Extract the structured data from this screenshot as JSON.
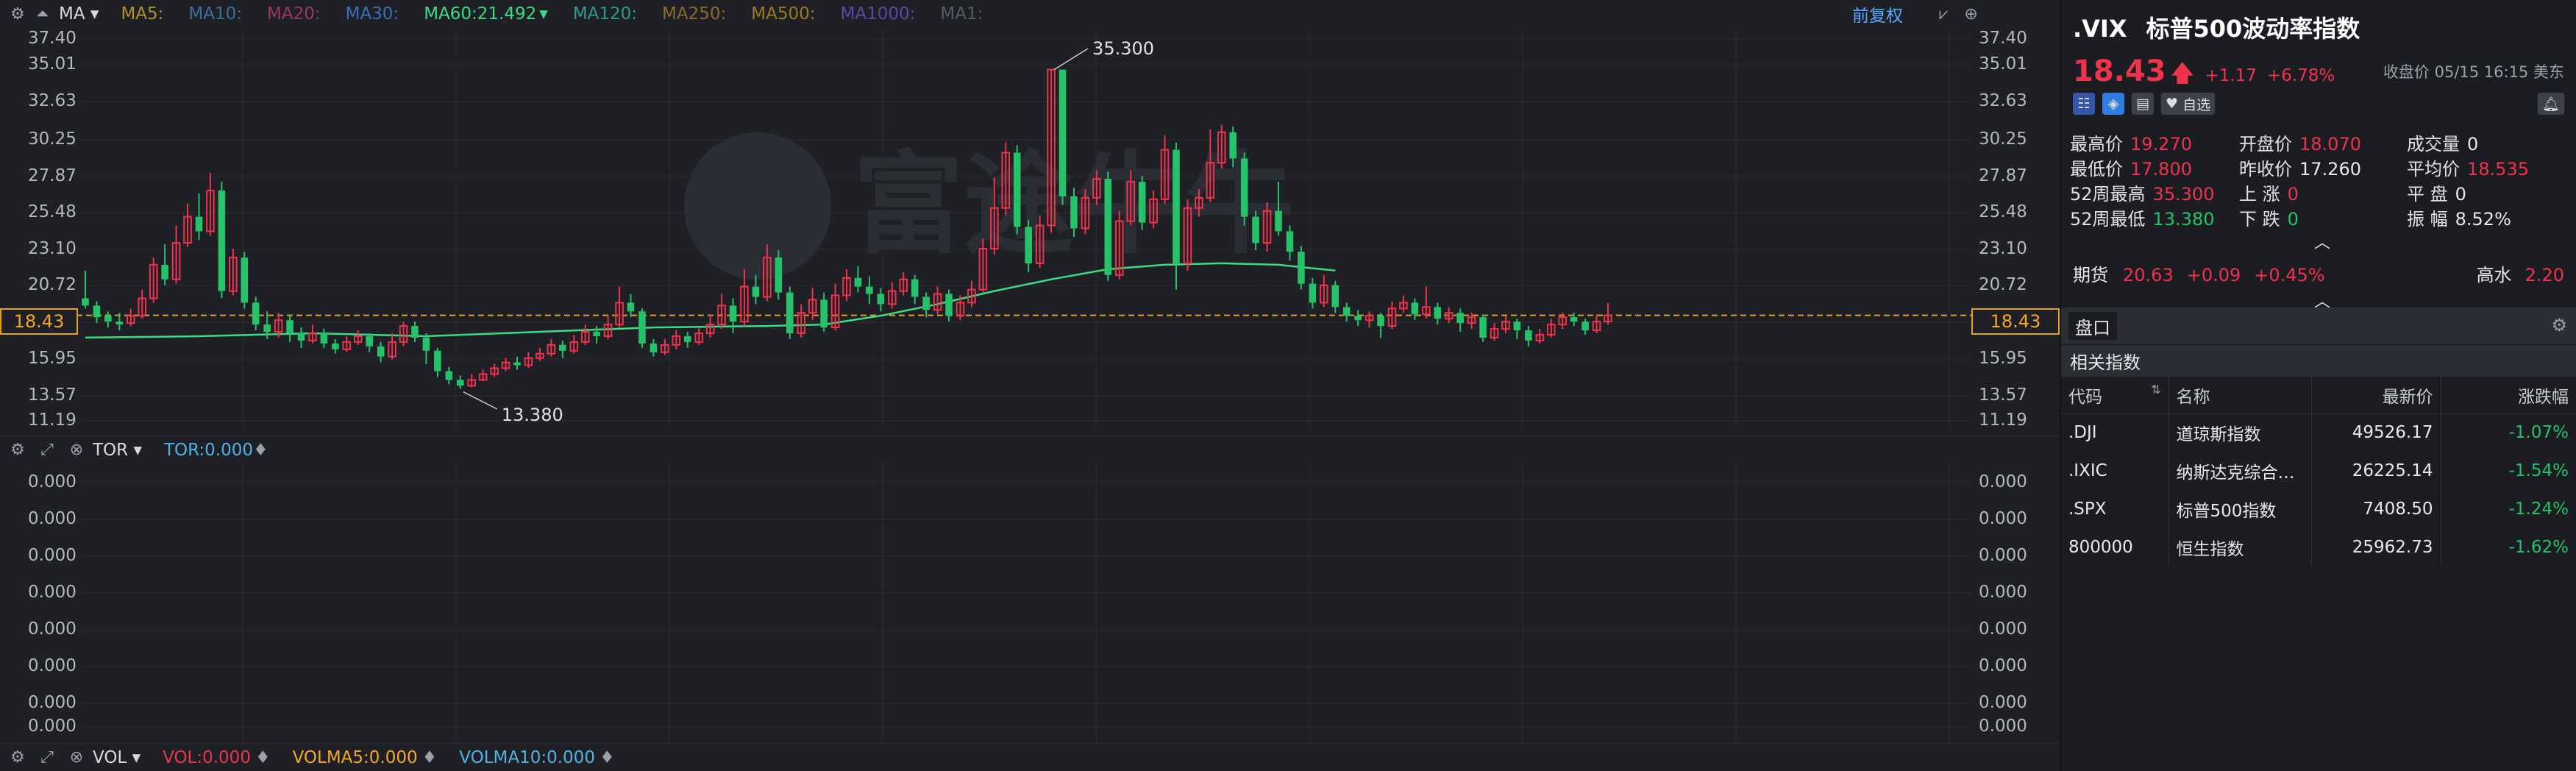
{
  "chart": {
    "toolbar": {
      "ma_label": "MA",
      "ma_items": [
        {
          "label": "MA5:",
          "color": "#b1912a"
        },
        {
          "label": "MA10:",
          "color": "#3e6f9c"
        },
        {
          "label": "MA20:",
          "color": "#a0336d"
        },
        {
          "label": "MA30:",
          "color": "#3b6fb6"
        },
        {
          "label": "MA60:21.492",
          "color": "#3ddc84"
        },
        {
          "label": "MA120:",
          "color": "#2e9a8d"
        },
        {
          "label": "MA250:",
          "color": "#8a6a2c"
        },
        {
          "label": "MA500:",
          "color": "#9c7a1c"
        },
        {
          "label": "MA1000:",
          "color": "#5a4aa8"
        },
        {
          "label": "MA1:",
          "color": "#565b66"
        }
      ],
      "adjust_button": "前复权"
    },
    "price_axis": [
      "37.40",
      "35.01",
      "32.63",
      "30.25",
      "27.87",
      "25.48",
      "23.10",
      "20.72",
      "18.43",
      "15.95",
      "13.57",
      "11.19"
    ],
    "current_price_tag": "18.43",
    "high_annotation": "35.300",
    "low_annotation": "13.380",
    "tor": {
      "label": "TOR",
      "value_label": "TOR:0.000",
      "axis": [
        "0.000",
        "0.000",
        "0.000",
        "0.000",
        "0.000",
        "0.000",
        "0.000",
        "0.000"
      ]
    },
    "vol": {
      "label": "VOL",
      "vol": "VOL:0.000",
      "volma5": "VOLMA5:0.000",
      "volma10": "VOLMA10:0.000"
    },
    "watermark": "富途牛牛"
  },
  "chart_data": {
    "type": "candlestick",
    "ylim": [
      11.19,
      37.4
    ],
    "candles": [
      [
        19.6,
        19.1,
        21.5,
        18.9
      ],
      [
        19.1,
        18.3,
        19.4,
        17.9
      ],
      [
        18.4,
        18.0,
        18.7,
        17.6
      ],
      [
        18.0,
        17.8,
        18.6,
        17.4
      ],
      [
        17.9,
        18.4,
        18.9,
        17.7
      ],
      [
        18.4,
        19.6,
        20.2,
        18.2
      ],
      [
        19.6,
        21.9,
        22.4,
        19.3
      ],
      [
        21.9,
        20.9,
        23.3,
        20.5
      ],
      [
        20.9,
        23.4,
        24.6,
        20.6
      ],
      [
        23.4,
        25.2,
        26.1,
        23.1
      ],
      [
        25.2,
        24.2,
        26.8,
        23.6
      ],
      [
        24.2,
        27.0,
        28.2,
        23.9
      ],
      [
        27.0,
        20.1,
        27.6,
        19.6
      ],
      [
        20.1,
        22.4,
        23.0,
        19.8
      ],
      [
        22.4,
        19.3,
        22.8,
        18.9
      ],
      [
        19.3,
        17.8,
        19.7,
        17.4
      ],
      [
        17.8,
        17.3,
        18.7,
        16.8
      ],
      [
        17.3,
        18.1,
        18.6,
        16.9
      ],
      [
        18.1,
        17.2,
        18.5,
        16.6
      ],
      [
        17.2,
        16.7,
        17.6,
        16.2
      ],
      [
        16.7,
        17.2,
        17.8,
        16.5
      ],
      [
        17.2,
        16.5,
        17.5,
        16.2
      ],
      [
        16.5,
        16.1,
        16.8,
        15.8
      ],
      [
        16.1,
        16.6,
        17.0,
        15.9
      ],
      [
        16.6,
        17.0,
        17.4,
        16.4
      ],
      [
        17.0,
        16.3,
        17.2,
        15.9
      ],
      [
        16.3,
        15.6,
        16.6,
        15.2
      ],
      [
        15.6,
        16.6,
        17.2,
        15.4
      ],
      [
        16.6,
        17.7,
        18.0,
        16.3
      ],
      [
        17.7,
        16.9,
        18.0,
        16.6
      ],
      [
        16.9,
        16.0,
        17.2,
        15.1
      ],
      [
        16.0,
        14.6,
        16.2,
        14.2
      ],
      [
        14.6,
        14.0,
        14.9,
        13.7
      ],
      [
        14.0,
        13.6,
        14.3,
        13.38
      ],
      [
        13.6,
        14.0,
        14.4,
        13.5
      ],
      [
        14.0,
        14.4,
        14.7,
        13.9
      ],
      [
        14.4,
        14.8,
        15.1,
        14.2
      ],
      [
        14.8,
        15.2,
        15.5,
        14.6
      ],
      [
        15.2,
        15.0,
        15.6,
        14.7
      ],
      [
        15.0,
        15.5,
        15.9,
        14.8
      ],
      [
        15.5,
        15.8,
        16.2,
        15.3
      ],
      [
        15.8,
        16.4,
        16.8,
        15.6
      ],
      [
        16.4,
        16.0,
        16.7,
        15.5
      ],
      [
        16.0,
        16.6,
        17.1,
        15.8
      ],
      [
        16.6,
        17.3,
        17.8,
        16.4
      ],
      [
        17.3,
        17.0,
        17.7,
        16.5
      ],
      [
        17.0,
        17.8,
        18.4,
        16.8
      ],
      [
        17.8,
        19.3,
        20.4,
        17.6
      ],
      [
        19.3,
        18.7,
        19.9,
        18.3
      ],
      [
        18.7,
        16.5,
        18.9,
        16.2
      ],
      [
        16.5,
        15.9,
        16.8,
        15.6
      ],
      [
        15.9,
        16.4,
        16.8,
        15.7
      ],
      [
        16.4,
        17.0,
        17.4,
        16.1
      ],
      [
        17.0,
        16.6,
        17.3,
        16.2
      ],
      [
        16.6,
        17.2,
        17.6,
        16.4
      ],
      [
        17.2,
        17.8,
        18.5,
        16.9
      ],
      [
        17.8,
        19.1,
        19.9,
        17.5
      ],
      [
        19.1,
        18.0,
        19.6,
        17.2
      ],
      [
        18.0,
        20.4,
        21.6,
        17.7
      ],
      [
        20.4,
        19.7,
        21.2,
        19.2
      ],
      [
        19.7,
        22.4,
        23.3,
        19.4
      ],
      [
        22.4,
        20.0,
        22.9,
        19.5
      ],
      [
        20.0,
        17.2,
        20.4,
        16.8
      ],
      [
        17.2,
        18.6,
        19.2,
        16.9
      ],
      [
        18.6,
        19.5,
        20.3,
        18.1
      ],
      [
        19.5,
        17.6,
        20.0,
        17.3
      ],
      [
        17.6,
        19.8,
        20.6,
        17.4
      ],
      [
        19.8,
        21.0,
        21.6,
        19.4
      ],
      [
        21.0,
        20.4,
        21.8,
        20.0
      ],
      [
        20.4,
        19.9,
        21.1,
        19.2
      ],
      [
        19.9,
        19.2,
        20.3,
        18.7
      ],
      [
        19.2,
        20.1,
        20.7,
        18.9
      ],
      [
        20.1,
        20.9,
        21.4,
        19.8
      ],
      [
        20.9,
        19.7,
        21.2,
        19.2
      ],
      [
        19.7,
        18.8,
        20.0,
        18.3
      ],
      [
        18.8,
        19.9,
        20.4,
        18.5
      ],
      [
        19.9,
        18.4,
        20.2,
        18.0
      ],
      [
        18.4,
        19.3,
        19.8,
        18.1
      ],
      [
        19.3,
        20.2,
        20.8,
        19.0
      ],
      [
        20.2,
        23.0,
        23.7,
        20.0
      ],
      [
        23.0,
        25.8,
        27.9,
        22.6
      ],
      [
        25.8,
        29.6,
        30.3,
        25.3
      ],
      [
        29.6,
        24.5,
        30.1,
        24.0
      ],
      [
        24.5,
        22.0,
        25.0,
        21.4
      ],
      [
        22.0,
        24.6,
        25.3,
        21.7
      ],
      [
        24.6,
        35.3,
        35.3,
        24.1
      ],
      [
        35.3,
        26.6,
        35.0,
        26.0
      ],
      [
        26.6,
        24.4,
        27.2,
        23.8
      ],
      [
        24.4,
        26.5,
        27.1,
        24.0
      ],
      [
        26.5,
        27.8,
        28.4,
        26.0
      ],
      [
        27.8,
        21.2,
        28.3,
        20.8
      ],
      [
        21.2,
        24.9,
        25.6,
        20.9
      ],
      [
        24.9,
        27.6,
        28.4,
        24.6
      ],
      [
        27.6,
        24.8,
        28.0,
        24.3
      ],
      [
        24.8,
        26.4,
        27.0,
        24.4
      ],
      [
        26.4,
        29.8,
        30.8,
        26.1
      ],
      [
        29.8,
        22.0,
        30.3,
        20.2
      ],
      [
        22.0,
        25.8,
        26.4,
        21.5
      ],
      [
        25.8,
        26.5,
        27.1,
        25.2
      ],
      [
        26.5,
        28.9,
        31.2,
        26.2
      ],
      [
        28.9,
        31.0,
        31.5,
        28.5
      ],
      [
        31.0,
        29.2,
        31.4,
        28.6
      ],
      [
        29.2,
        25.2,
        29.6,
        24.6
      ],
      [
        25.2,
        23.4,
        25.6,
        22.9
      ],
      [
        23.4,
        25.6,
        26.2,
        22.8
      ],
      [
        25.6,
        24.2,
        27.6,
        23.9
      ],
      [
        24.2,
        22.8,
        24.6,
        22.2
      ],
      [
        22.8,
        20.6,
        23.2,
        20.2
      ],
      [
        20.6,
        19.3,
        21.0,
        18.9
      ],
      [
        19.3,
        20.5,
        21.2,
        19.0
      ],
      [
        20.5,
        19.0,
        20.8,
        18.6
      ],
      [
        19.0,
        18.4,
        19.3,
        18.0
      ],
      [
        18.4,
        18.1,
        18.8,
        17.7
      ],
      [
        18.1,
        18.4,
        18.7,
        17.6
      ],
      [
        18.4,
        17.7,
        18.6,
        16.9
      ],
      [
        17.7,
        18.9,
        19.4,
        17.5
      ],
      [
        18.9,
        19.3,
        19.8,
        18.6
      ],
      [
        19.3,
        18.5,
        19.6,
        18.1
      ],
      [
        18.5,
        19.0,
        20.4,
        18.2
      ],
      [
        19.0,
        18.2,
        19.3,
        17.8
      ],
      [
        18.2,
        18.6,
        19.0,
        17.9
      ],
      [
        18.6,
        17.9,
        18.9,
        17.3
      ],
      [
        17.9,
        18.3,
        18.6,
        17.5
      ],
      [
        18.3,
        16.9,
        18.5,
        16.6
      ],
      [
        16.9,
        17.5,
        17.9,
        16.7
      ],
      [
        17.5,
        18.0,
        18.4,
        17.2
      ],
      [
        18.0,
        17.4,
        18.2,
        16.8
      ],
      [
        17.4,
        16.7,
        17.7,
        16.3
      ],
      [
        16.7,
        17.1,
        17.5,
        16.5
      ],
      [
        17.1,
        17.8,
        18.2,
        16.9
      ],
      [
        17.8,
        18.3,
        18.6,
        17.5
      ],
      [
        18.3,
        18.0,
        18.6,
        17.7
      ],
      [
        18.0,
        17.4,
        18.2,
        17.1
      ],
      [
        17.4,
        18.0,
        18.5,
        17.2
      ],
      [
        18.0,
        18.43,
        19.27,
        17.8
      ]
    ],
    "ma60": [
      [
        0,
        16.9
      ],
      [
        10,
        17.0
      ],
      [
        20,
        17.2
      ],
      [
        30,
        17.0
      ],
      [
        40,
        17.3
      ],
      [
        50,
        17.6
      ],
      [
        60,
        17.7
      ],
      [
        65,
        17.8
      ],
      [
        70,
        18.4
      ],
      [
        75,
        19.2
      ],
      [
        80,
        20.1
      ],
      [
        85,
        20.9
      ],
      [
        90,
        21.6
      ],
      [
        95,
        21.9
      ],
      [
        100,
        22.0
      ],
      [
        105,
        21.9
      ],
      [
        110,
        21.5
      ]
    ]
  },
  "panel": {
    "symbol": ".VIX",
    "name": "标普500波动率指数",
    "last_price": "18.43",
    "change": "+1.17",
    "change_pct": "+6.78%",
    "quote_time": "收盘价 05/15 16:15 美东",
    "watch_label": "自选",
    "stats": {
      "high": {
        "label": "最高价",
        "value": "19.270"
      },
      "low": {
        "label": "最低价",
        "value": "17.800"
      },
      "high52": {
        "label": "52周最高",
        "value": "35.300"
      },
      "low52": {
        "label": "52周最低",
        "value": "13.380"
      },
      "open": {
        "label": "开盘价",
        "value": "18.070"
      },
      "prev_close": {
        "label": "昨收价",
        "value": "17.260"
      },
      "up": {
        "label": "上 涨",
        "value": "0"
      },
      "down": {
        "label": "下 跌",
        "value": "0"
      },
      "volume": {
        "label": "成交量",
        "value": "0"
      },
      "avg": {
        "label": "平均价",
        "value": "18.535"
      },
      "flat": {
        "label": "平 盘",
        "value": "0"
      },
      "amplitude": {
        "label": "振 幅",
        "value": "8.52%"
      }
    },
    "futures": {
      "label": "期货",
      "price": "20.63",
      "change": "+0.09",
      "change_pct": "+0.45%",
      "premium_label": "高水",
      "premium": "2.20"
    },
    "pankou_tab": "盘口",
    "related_title": "相关指数",
    "table": {
      "headers": [
        "代码",
        "名称",
        "最新价",
        "涨跌幅"
      ],
      "rows": [
        {
          "code": ".DJI",
          "name": "道琼斯指数",
          "price": "49526.17",
          "pct": "-1.07%"
        },
        {
          "code": ".IXIC",
          "name": "纳斯达克综合…",
          "price": "26225.14",
          "pct": "-1.54%"
        },
        {
          "code": ".SPX",
          "name": "标普500指数",
          "price": "7408.50",
          "pct": "-1.24%"
        },
        {
          "code": "800000",
          "name": "恒生指数",
          "price": "25962.73",
          "pct": "-1.62%"
        }
      ]
    }
  }
}
